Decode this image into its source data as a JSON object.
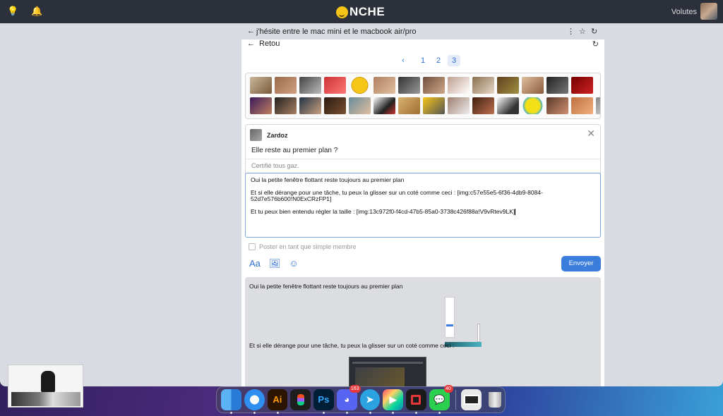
{
  "topbar": {
    "logo_text": "NCHE",
    "user_name": "Volutes",
    "icons": [
      "lightbulb-icon",
      "bell-icon"
    ]
  },
  "thread": {
    "title": "j'hésite entre le mac mini et le macbook air/pro",
    "back_label": "Retou"
  },
  "pagination": {
    "prev": "‹",
    "pages": [
      "1",
      "2",
      "3"
    ],
    "active_page": "3"
  },
  "quoted_post": {
    "author": "Zardoz",
    "message": "Elle reste au premier plan ?",
    "signature": "Certifié tous gaz."
  },
  "editor": {
    "line1": "Oui la petite fenêtre flottant reste toujours au premier plan",
    "line2": "Et si elle dérange pour une tâche, tu peux la glisser sur un coté comme ceci : [img:c57e55e5-6f36-4db9-8084-52d7e576b600!N0ExCRzFP1]",
    "line3": "Et tu peux bien entendu régler la taille : [img:13c972f0-f4cd-47b5-85a0-3738c426f88a!V9vRtev9LK]"
  },
  "options": {
    "checkbox_label": "Poster en tant que simple membre",
    "text_format_label": "Aa",
    "send_label": "Envoyer"
  },
  "preview": {
    "line1": "Oui la petite fenêtre flottant reste toujours au premier plan",
    "line2": "Et si elle dérange pour une tâche, tu peux la glisser sur un coté comme ceci :"
  },
  "dock": {
    "apps": [
      {
        "name": "finder",
        "label": "",
        "badge": ""
      },
      {
        "name": "safari",
        "label": "",
        "badge": ""
      },
      {
        "name": "illustrator",
        "label": "Ai",
        "badge": ""
      },
      {
        "name": "figma",
        "label": "",
        "badge": ""
      },
      {
        "name": "photoshop",
        "label": "Ps",
        "badge": ""
      },
      {
        "name": "discord",
        "label": "",
        "badge": "163"
      },
      {
        "name": "telegram",
        "label": "",
        "badge": ""
      },
      {
        "name": "final-cut",
        "label": "",
        "badge": ""
      },
      {
        "name": "screen-app",
        "label": "",
        "badge": ""
      },
      {
        "name": "messages",
        "label": "",
        "badge": "40"
      }
    ]
  }
}
